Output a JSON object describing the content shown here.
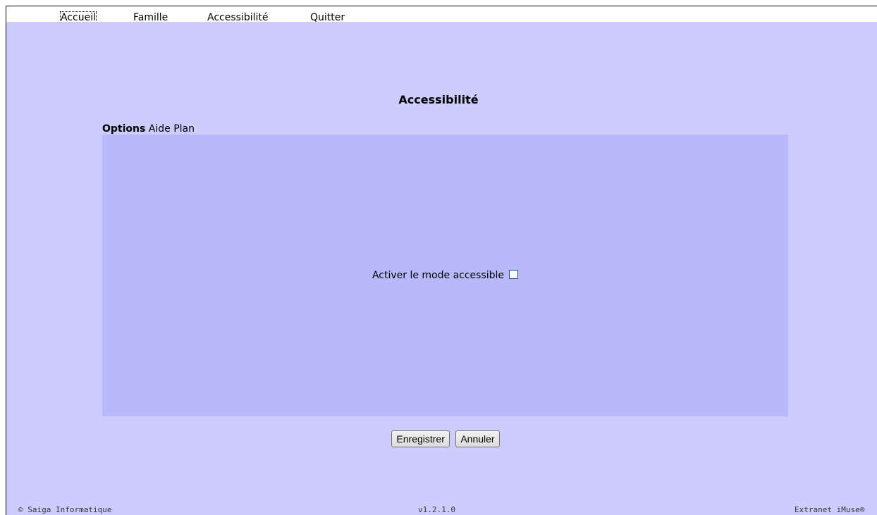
{
  "menu": {
    "items": [
      {
        "label": "Accueil"
      },
      {
        "label": "Famille"
      },
      {
        "label": "Accessibilité"
      },
      {
        "label": "Quitter"
      }
    ]
  },
  "page": {
    "title": "Accessibilité"
  },
  "tabs": {
    "options": "Options",
    "aide": "Aide",
    "plan": "Plan"
  },
  "panel": {
    "option_label": "Activer le mode accessible",
    "checkbox_checked": false
  },
  "buttons": {
    "save": "Enregistrer",
    "cancel": "Annuler"
  },
  "footer": {
    "left": "© Saiga Informatique",
    "center": "v1.2.1.0",
    "right": "Extranet iMuse®"
  },
  "colors": {
    "page_background": "#ccccfd",
    "panel_background": "#b8b9fc"
  }
}
